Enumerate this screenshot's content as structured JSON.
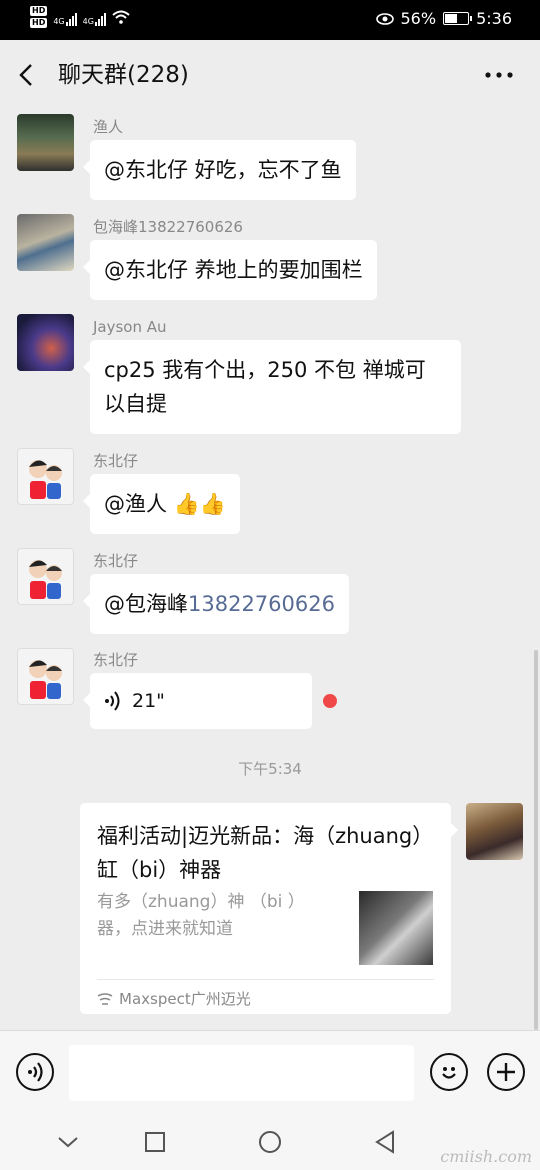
{
  "status_bar": {
    "hd1": "HD",
    "hd2": "HD",
    "net1": "4G",
    "net2": "4G",
    "battery_percent": "56%",
    "battery_level": 0.56,
    "time": "5:36"
  },
  "header": {
    "title": "聊天群(228)",
    "back_icon": "chevron-left-icon",
    "more_icon": "ellipsis-icon"
  },
  "messages": [
    {
      "sender": "渔人",
      "text": "@东北仔  好吃，忘不了鱼"
    },
    {
      "sender": "包海峰13822760626",
      "text": "@东北仔  养地上的要加围栏"
    },
    {
      "sender": "Jayson Au",
      "text_line1": "cp25 我有个出，250 不包 禅城可",
      "text_line2": "以自提"
    },
    {
      "sender": "东北仔",
      "text": "@渔人 ",
      "emoji": "👍👍"
    },
    {
      "sender": "东北仔",
      "text": "@包海峰",
      "phone": "13822760626"
    },
    {
      "sender": "东北仔",
      "voice_duration": "21\""
    }
  ],
  "timestamp": "下午5:34",
  "share_card": {
    "title": "福利活动|迈光新品：海（zhuang）缸（bi）神器",
    "description": "有多（zhuang）神 （bi ）器，点进来就知道",
    "source": "Maxspect广州迈光"
  },
  "input_bar": {
    "voice_icon": "voice-input-icon",
    "emoji_icon": "emoji-icon",
    "plus_icon": "plus-icon",
    "text_value": ""
  },
  "watermark": "cmiish.com"
}
